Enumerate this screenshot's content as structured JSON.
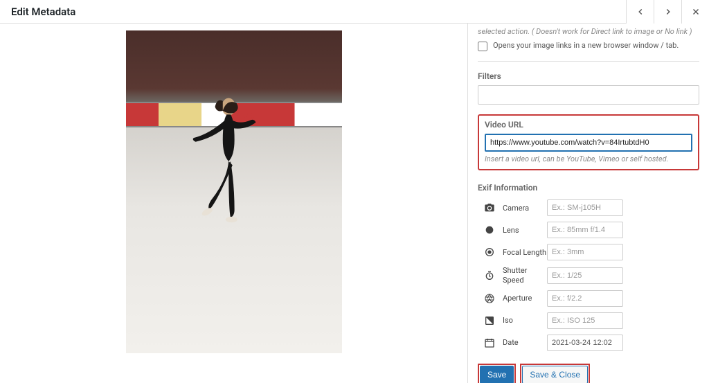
{
  "header": {
    "title": "Edit Metadata"
  },
  "sidebar": {
    "truncated_note": "selected action. ( Doesn't work for Direct link to image or No link )",
    "new_tab_label": "Opens your image links in a new browser window / tab.",
    "filters_label": "Filters",
    "video": {
      "label": "Video URL",
      "value": "https://www.youtube.com/watch?v=84IrtubtdH0",
      "hint": "Insert a video url, can be YouTube, Vimeo or self hosted."
    },
    "exif": {
      "heading": "Exif Information",
      "camera": {
        "label": "Camera",
        "placeholder": "Ex.: SM-j105H",
        "value": ""
      },
      "lens": {
        "label": "Lens",
        "placeholder": "Ex.: 85mm f/1.4",
        "value": ""
      },
      "focal": {
        "label": "Focal Length",
        "placeholder": "Ex.: 3mm",
        "value": ""
      },
      "shutter": {
        "label": "Shutter Speed",
        "placeholder": "Ex.: 1/25",
        "value": ""
      },
      "aperture": {
        "label": "Aperture",
        "placeholder": "Ex.: f/2.2",
        "value": ""
      },
      "iso": {
        "label": "Iso",
        "placeholder": "Ex.: ISO 125",
        "value": ""
      },
      "date": {
        "label": "Date",
        "placeholder": "",
        "value": "2021-03-24 12:02"
      }
    },
    "actions": {
      "save": "Save",
      "save_close": "Save & Close"
    }
  }
}
